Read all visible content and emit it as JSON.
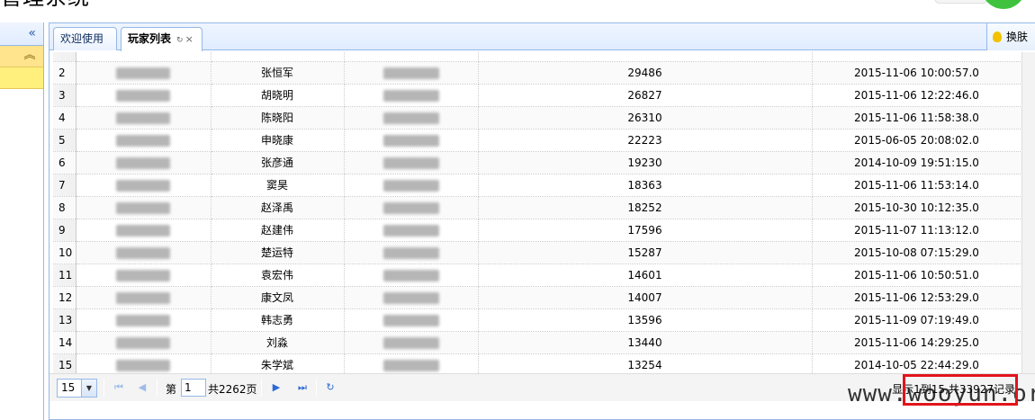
{
  "app_title": "管理系统",
  "tabs": [
    {
      "label": "欢迎使用"
    },
    {
      "label": "玩家列表",
      "refresh_icon": "↻",
      "close_icon": "×"
    }
  ],
  "skin_button": {
    "label": "换肤"
  },
  "sidebar": {
    "collapse_glyph": "«",
    "expand_glyph": "︽"
  },
  "grid": {
    "rows": [
      {
        "num": "2",
        "name": "张恒军",
        "value": "29486",
        "time": "2015-11-06 10:00:57.0"
      },
      {
        "num": "3",
        "name": "胡晓明",
        "value": "26827",
        "time": "2015-11-06 12:22:46.0"
      },
      {
        "num": "4",
        "name": "陈晓阳",
        "value": "26310",
        "time": "2015-11-06 11:58:38.0"
      },
      {
        "num": "5",
        "name": "申晓康",
        "value": "22223",
        "time": "2015-06-05 20:08:02.0"
      },
      {
        "num": "6",
        "name": "张彦通",
        "value": "19230",
        "time": "2014-10-09 19:51:15.0"
      },
      {
        "num": "7",
        "name": "窦昊",
        "value": "18363",
        "time": "2015-11-06 11:53:14.0"
      },
      {
        "num": "8",
        "name": "赵泽禹",
        "value": "18252",
        "time": "2015-10-30 10:12:35.0"
      },
      {
        "num": "9",
        "name": "赵建伟",
        "value": "17596",
        "time": "2015-11-07 11:13:12.0"
      },
      {
        "num": "10",
        "name": "楚运特",
        "value": "15287",
        "time": "2015-10-08 07:15:29.0"
      },
      {
        "num": "11",
        "name": "袁宏伟",
        "value": "14601",
        "time": "2015-11-06 10:50:51.0"
      },
      {
        "num": "12",
        "name": "康文凤",
        "value": "14007",
        "time": "2015-11-06 12:53:29.0"
      },
      {
        "num": "13",
        "name": "韩志勇",
        "value": "13596",
        "time": "2015-11-09 07:19:49.0"
      },
      {
        "num": "14",
        "name": "刘淼",
        "value": "13440",
        "time": "2015-11-06 14:29:25.0"
      },
      {
        "num": "15",
        "name": "朱学斌",
        "value": "13254",
        "time": "2014-10-05 22:44:29.0"
      }
    ]
  },
  "pager": {
    "page_size": "15",
    "page_prefix": "第",
    "current_page": "1",
    "total_pages": "共2262页",
    "info": "显示1到15,共33927记录"
  },
  "watermark": "www.wooyun.org"
}
